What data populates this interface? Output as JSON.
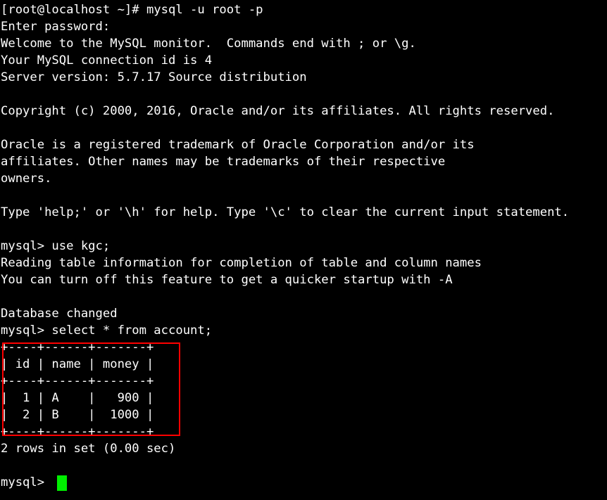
{
  "terminal": {
    "window_title": "root@localhost:~",
    "shell_prompt": "[root@localhost ~]#",
    "mysql_prompt": "mysql>",
    "background_color": "#000000",
    "foreground_color": "#ffffff",
    "cursor_color": "#00ee00",
    "annotation_color": "#ff0000",
    "columns": 75,
    "rows": 29
  },
  "session": {
    "command_login": "mysql -u root -p",
    "password_prompt": "Enter password:",
    "connection_id": "4",
    "server_version": "5.7.17",
    "server_distribution": "Source distribution",
    "database_selected": "kgc",
    "query": "select * from account;",
    "result_status": "2 rows in set (0.00 sec)"
  },
  "lines": [
    {
      "id": "line-shell-prompt",
      "text": "[root@localhost ~]# mysql -u root -p"
    },
    {
      "id": "line-password",
      "text": "Enter password:"
    },
    {
      "id": "line-welcome",
      "text": "Welcome to the MySQL monitor.  Commands end with ; or \\g."
    },
    {
      "id": "line-connection-id",
      "text": "Your MySQL connection id is 4"
    },
    {
      "id": "line-server-version",
      "text": "Server version: 5.7.17 Source distribution"
    },
    {
      "id": "line-blank-1",
      "text": ""
    },
    {
      "id": "line-copyright",
      "text": "Copyright (c) 2000, 2016, Oracle and/or its affiliates. All rights reserved."
    },
    {
      "id": "line-blank-2",
      "text": ""
    },
    {
      "id": "line-trademark-1",
      "text": "Oracle is a registered trademark of Oracle Corporation and/or its"
    },
    {
      "id": "line-trademark-2",
      "text": "affiliates. Other names may be trademarks of their respective"
    },
    {
      "id": "line-trademark-3",
      "text": "owners."
    },
    {
      "id": "line-blank-3",
      "text": ""
    },
    {
      "id": "line-help-hint",
      "text": "Type 'help;' or '\\h' for help. Type '\\c' to clear the current input statement."
    },
    {
      "id": "line-blank-4",
      "text": ""
    },
    {
      "id": "line-use-db",
      "text": "mysql> use kgc;"
    },
    {
      "id": "line-reading-table",
      "text": "Reading table information for completion of table and column names"
    },
    {
      "id": "line-turn-off",
      "text": "You can turn off this feature to get a quicker startup with -A"
    },
    {
      "id": "line-blank-5",
      "text": ""
    },
    {
      "id": "line-db-changed",
      "text": "Database changed"
    },
    {
      "id": "line-select-query",
      "text": "mysql> select * from account;"
    },
    {
      "id": "line-table-top",
      "text": "+----+------+-------+"
    },
    {
      "id": "line-table-header",
      "text": "| id | name | money |"
    },
    {
      "id": "line-table-sep",
      "text": "+----+------+-------+"
    },
    {
      "id": "line-table-row-1",
      "text": "|  1 | A    |   900 |"
    },
    {
      "id": "line-table-row-2",
      "text": "|  2 | B    |  1000 |"
    },
    {
      "id": "line-table-bottom",
      "text": "+----+------+-------+"
    },
    {
      "id": "line-rows-in-set",
      "text": "2 rows in set (0.00 sec)"
    },
    {
      "id": "line-blank-6",
      "text": ""
    },
    {
      "id": "line-final-prompt",
      "text": "mysql> "
    }
  ],
  "result_table": {
    "headers": [
      "id",
      "name",
      "money"
    ],
    "rows": [
      {
        "id": "1",
        "name": "A",
        "money": "900"
      },
      {
        "id": "2",
        "name": "B",
        "money": "1000"
      }
    ],
    "row_count": 2,
    "elapsed_seconds": "0.00",
    "border_top": "+----+------+-------+",
    "border_separator": "+----+------+-------+",
    "border_bottom": "+----+------+-------+"
  },
  "annotation": {
    "type": "rectangle-highlight",
    "color": "#ff0000",
    "target": "result-table"
  }
}
